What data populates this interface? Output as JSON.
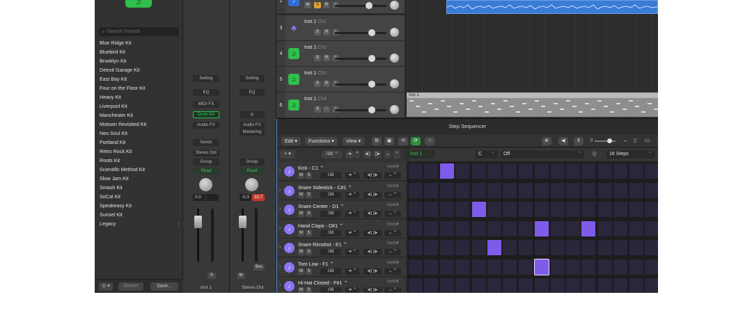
{
  "library": {
    "search_placeholder": "Search Sounds",
    "items": [
      "Blue Ridge Kit",
      "Bluebird Kit",
      "Brooklyn Kit",
      "Detroit Garage Kit",
      "East Bay Kit",
      "Four on the Floor Kit",
      "Heavy Kit",
      "Liverpool Kit",
      "Manchester Kit",
      "Motown Revisited Kit",
      "Neo Soul Kit",
      "Portland Kit",
      "Retro Rock Kit",
      "Roots Kit",
      "Scientific Method Kit",
      "Slow Jam Kit",
      "Smash Kit",
      "SoCal Kit",
      "Speakeasy Kit",
      "Sunset Kit",
      "Legacy"
    ],
    "revert_label": "Revert",
    "save_label": "Save..."
  },
  "strip1": {
    "setting": "Setting",
    "eq": "EQ",
    "midi_fx": "MIDI FX",
    "instrument": "Drum Kit",
    "audio_fx": "Audio FX",
    "sends": "Sends",
    "output": "Stereo Out",
    "group": "Group",
    "automation": "Read",
    "pan_value": "0,0",
    "solo": "S",
    "name": "Inst 1"
  },
  "strip2": {
    "setting": "Setting",
    "eq": "EQ",
    "link": "◎",
    "audio_fx": "Audio FX",
    "mastering": "Mastering",
    "group": "Group",
    "automation": "Read",
    "pan_value": "-0,3",
    "peak_value": "10,7",
    "bounce": "Bnc",
    "mute": "M",
    "name": "Stereo Out"
  },
  "tracks": [
    {
      "num": "2",
      "name": "",
      "channel": "",
      "icon": "waveform-icon"
    },
    {
      "num": "3",
      "name": "Inst 1",
      "channel": "Ch1",
      "icon": "drummer-icon"
    },
    {
      "num": "4",
      "name": "Inst 1",
      "channel": "Ch2",
      "icon": "music-note-icon"
    },
    {
      "num": "5",
      "name": "Inst 1",
      "channel": "Ch3",
      "icon": "music-note-icon"
    },
    {
      "num": "6",
      "name": "Inst 1",
      "channel": "Ch4",
      "icon": "music-note-icon"
    }
  ],
  "track_buttons": {
    "mute": "M",
    "solo": "S",
    "record": "R",
    "input": "I"
  },
  "midi_region_label": "Inst 1",
  "sequencer": {
    "title": "Step Sequencer",
    "menu_edit": "Edit",
    "menu_functions": "Functions",
    "menu_view": "View",
    "add": "+",
    "rate": "/16",
    "pattern_name": "Inst 1",
    "key": "C",
    "scale": "Off",
    "q": "Q",
    "steps": "16 Steps",
    "row_onoff": "On/Off",
    "row_mute": "M",
    "row_solo": "S",
    "rows": [
      {
        "name": "Kick - C1"
      },
      {
        "name": "Snare Sidestick - C#1"
      },
      {
        "name": "Snare Center - D1"
      },
      {
        "name": "Hand Claps - D#1"
      },
      {
        "name": "Snare Rimshot - E1"
      },
      {
        "name": "Tom Low - F1"
      },
      {
        "name": "Hi-Hat Closed - F#1"
      }
    ],
    "pattern": [
      [
        0,
        0,
        1,
        0,
        0,
        0,
        0,
        0,
        0,
        0,
        0,
        0,
        0,
        0,
        0,
        0
      ],
      [
        0,
        0,
        0,
        0,
        0,
        0,
        0,
        0,
        0,
        0,
        0,
        0,
        0,
        0,
        0,
        0
      ],
      [
        0,
        0,
        0,
        0,
        1,
        0,
        0,
        0,
        0,
        0,
        0,
        0,
        0,
        0,
        0,
        0
      ],
      [
        0,
        0,
        0,
        0,
        0,
        0,
        0,
        0,
        1,
        0,
        0,
        1,
        0,
        0,
        0,
        0
      ],
      [
        0,
        0,
        0,
        0,
        0,
        1,
        0,
        0,
        0,
        0,
        0,
        0,
        0,
        0,
        0,
        0
      ],
      [
        0,
        0,
        0,
        0,
        0,
        0,
        0,
        0,
        2,
        0,
        0,
        0,
        0,
        0,
        0,
        0
      ],
      [
        0,
        0,
        0,
        0,
        0,
        0,
        0,
        0,
        0,
        0,
        0,
        0,
        0,
        0,
        0,
        0
      ]
    ]
  },
  "colors": {
    "step_on": "#7f5bea",
    "step_off": "#2a263b",
    "accent_green": "#2fbf4a",
    "region_blue": "#3a7bd5"
  }
}
